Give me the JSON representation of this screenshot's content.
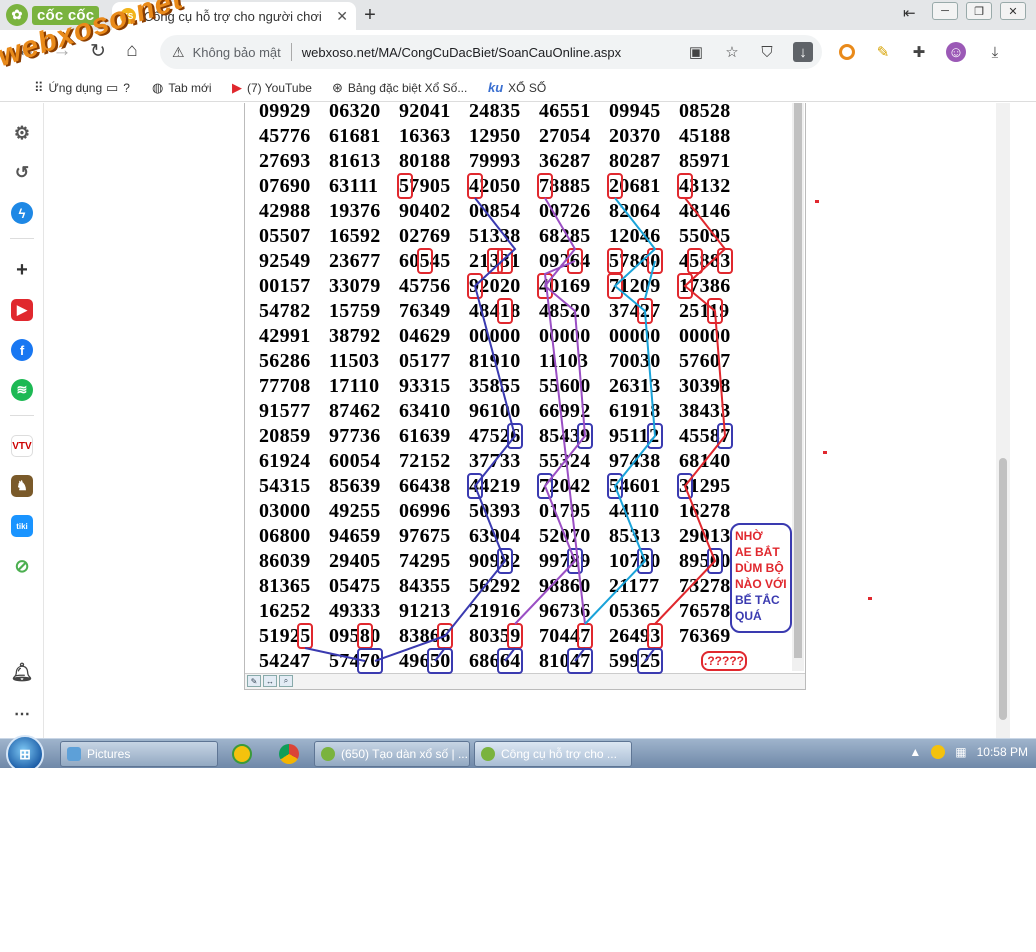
{
  "browser": {
    "brand": "cốc cốc",
    "tab_favicon": "XS",
    "tab_title": "Công cụ hỗ trợ cho người chơi",
    "new_tab": "+",
    "security_text": "Không bảo mật",
    "url": "webxoso.net/MA/CongCuDacBiet/SoanCauOnline.aspx",
    "watermark": "webxoso.net"
  },
  "bookmarks": [
    {
      "label": "Ứng dụng",
      "icon": "apps-icon"
    },
    {
      "label": "?",
      "icon": "folder-icon"
    },
    {
      "label": "Tab mới",
      "icon": "globe-icon"
    },
    {
      "label": "(7) YouTube",
      "icon": "youtube-icon"
    },
    {
      "label": "Bảng đặc biệt Xổ Số...",
      "icon": "xoso-icon"
    },
    {
      "label": "XỔ SỐ",
      "icon": "ku-icon"
    }
  ],
  "grid": [
    [
      "09929",
      "06320",
      "92041",
      "24835",
      "46551",
      "09945",
      "08528"
    ],
    [
      "45776",
      "61681",
      "16363",
      "12950",
      "27054",
      "20370",
      "45188"
    ],
    [
      "27693",
      "81613",
      "80188",
      "79993",
      "36287",
      "80287",
      "85971"
    ],
    [
      "07690",
      "63111",
      "57905",
      "42050",
      "78885",
      "20681",
      "43132"
    ],
    [
      "42988",
      "19376",
      "90402",
      "00854",
      "00726",
      "82064",
      "48146"
    ],
    [
      "05507",
      "16592",
      "02769",
      "51338",
      "68285",
      "12046",
      "55095"
    ],
    [
      "92549",
      "23677",
      "60545",
      "21331",
      "09264",
      "57860",
      "45883"
    ],
    [
      "00157",
      "33079",
      "45756",
      "92020",
      "40169",
      "71209",
      "17386"
    ],
    [
      "54782",
      "15759",
      "76349",
      "48418",
      "48520",
      "37427",
      "25119"
    ],
    [
      "42991",
      "38792",
      "04629",
      "00000",
      "00000",
      "00000",
      "00000"
    ],
    [
      "56286",
      "11503",
      "05177",
      "81910",
      "11103",
      "70030",
      "57607"
    ],
    [
      "77708",
      "17110",
      "93315",
      "35855",
      "55600",
      "26313",
      "30398"
    ],
    [
      "91577",
      "87462",
      "63410",
      "96100",
      "66992",
      "61918",
      "38433"
    ],
    [
      "20859",
      "97736",
      "61639",
      "47526",
      "85439",
      "95112",
      "45587"
    ],
    [
      "61924",
      "60054",
      "72152",
      "37733",
      "55324",
      "97438",
      "68140"
    ],
    [
      "54315",
      "85639",
      "66438",
      "44219",
      "72042",
      "54601",
      "31295"
    ],
    [
      "03000",
      "49255",
      "06996",
      "50393",
      "01795",
      "44110",
      "16278"
    ],
    [
      "06800",
      "94659",
      "97675",
      "63904",
      "52070",
      "85313",
      "29013"
    ],
    [
      "86039",
      "29405",
      "74295",
      "90982",
      "99789",
      "10780",
      "89500"
    ],
    [
      "81365",
      "05475",
      "84355",
      "56292",
      "98860",
      "21177",
      "73278"
    ],
    [
      "16252",
      "49333",
      "91213",
      "21916",
      "96736",
      "05365",
      "76578"
    ],
    [
      "51925",
      "09580",
      "83866",
      "80359",
      "70447",
      "26493",
      "76369"
    ],
    [
      "54247",
      "57470",
      "49650",
      "68664",
      "81047",
      "59925",
      ""
    ]
  ],
  "note": {
    "line1": "NHỜ",
    "line2": "AE BẮT",
    "line3": "DÙM BỘ",
    "line4": "NÀO VỚI",
    "line5": "BẾ TẮC",
    "line6": "QUÁ"
  },
  "question": ".?????",
  "taskbar": {
    "items": [
      "Pictures",
      "(650) Tạo dàn xổ số | ...",
      "Công cụ hỗ trợ cho ..."
    ],
    "clock": "10:58 PM"
  },
  "colors": {
    "red": "#e0282e",
    "blue": "#3a3ab0",
    "purple": "#9a4fc4",
    "cyan": "#1aa3d9",
    "coccoc_green": "#7ab33e"
  }
}
